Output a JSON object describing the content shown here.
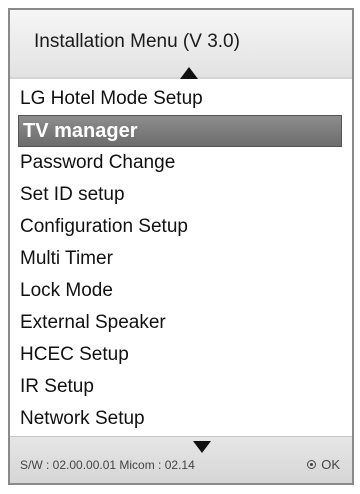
{
  "header": {
    "title": "Installation Menu (V 3.0)"
  },
  "menu": {
    "items": [
      {
        "label": "LG Hotel Mode Setup"
      },
      {
        "label": "TV manager"
      },
      {
        "label": "Password Change"
      },
      {
        "label": "Set ID setup"
      },
      {
        "label": "Configuration Setup"
      },
      {
        "label": "Multi Timer"
      },
      {
        "label": "Lock Mode"
      },
      {
        "label": "External Speaker"
      },
      {
        "label": "HCEC Setup"
      },
      {
        "label": "IR Setup"
      },
      {
        "label": "Network Setup"
      }
    ],
    "selected_label": "TV manager"
  },
  "footer": {
    "version": "S/W : 02.00.00.01 Micom : 02.14",
    "ok_label": "OK",
    "ok_icon": "ok-button-icon"
  },
  "icons": {
    "scroll_up": "scroll-up-icon",
    "scroll_down": "scroll-down-icon"
  },
  "colors": {
    "selected_bg": "#7a7a7a",
    "selected_text": "#ffffff",
    "border": "#8a8a8a"
  }
}
